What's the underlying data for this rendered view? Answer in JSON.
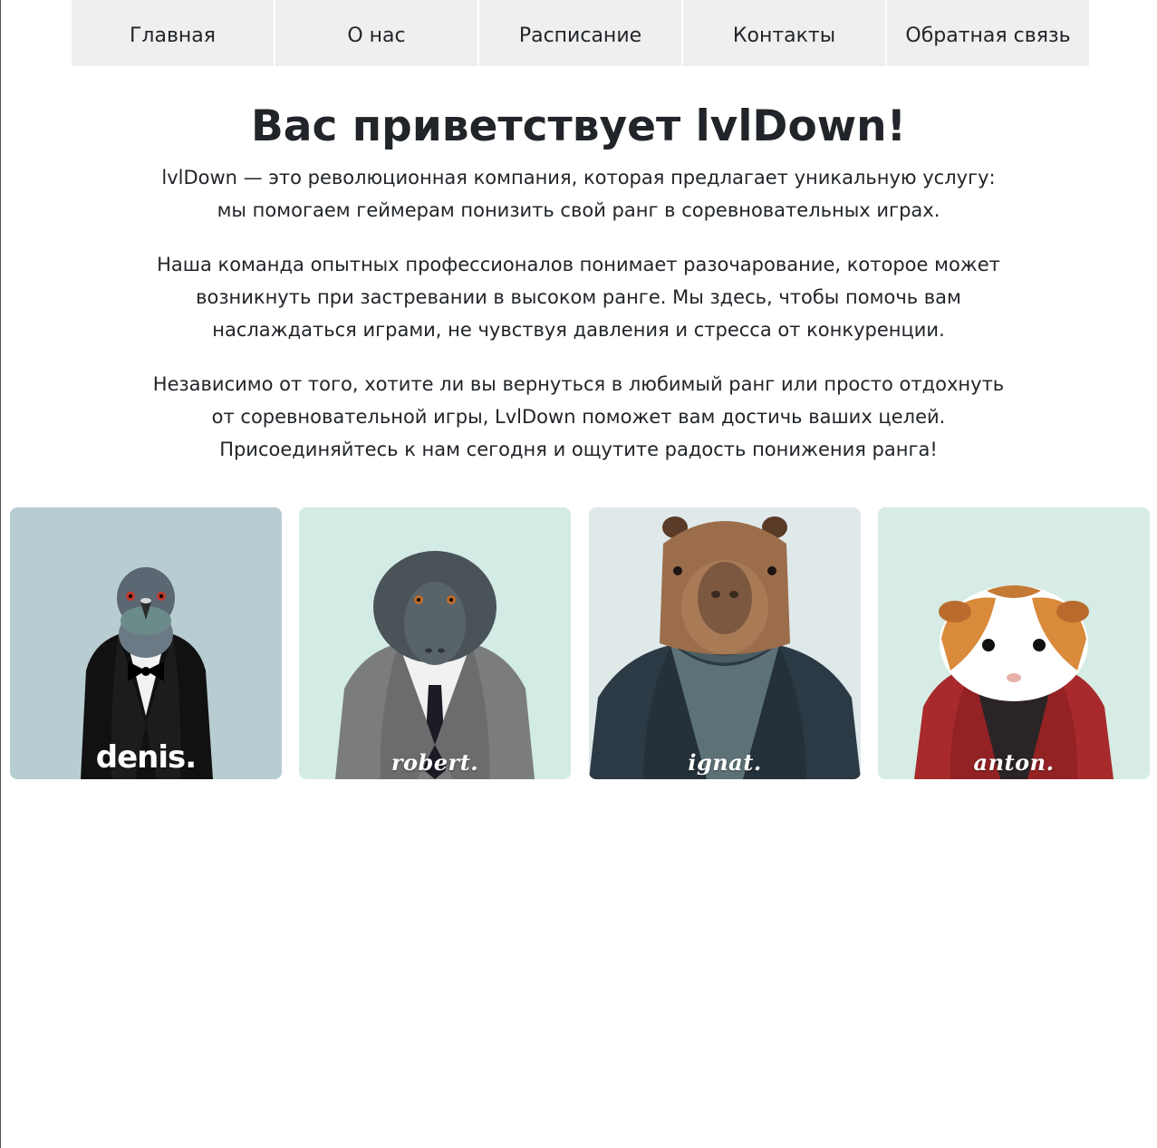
{
  "nav": {
    "items": [
      {
        "label": "Главная"
      },
      {
        "label": "О нас"
      },
      {
        "label": "Расписание"
      },
      {
        "label": "Контакты"
      },
      {
        "label": "Обратная связь"
      }
    ]
  },
  "main": {
    "title": "Вас приветствует lvlDown!",
    "paragraphs": [
      "lvlDown — это революционная компания, которая предлагает уникальную услугу: мы помогаем геймерам понизить свой ранг в соревновательных играх.",
      "Наша команда опытных профессионалов понимает разочарование, которое может возникнуть при застревании в высоком ранге. Мы здесь, чтобы помочь вам наслаждаться играми, не чувствуя давления и стресса от конкуренции.",
      "Независимо от того, хотите ли вы вернуться в любимый ранг или просто отдохнуть от соревновательной игры, LvlDown поможет вам достичь ваших целей. Присоединяйтесь к нам сегодня и ощутите радость понижения ранга!"
    ]
  },
  "team": {
    "members": [
      {
        "caption": "denis.",
        "animal_icon": "pigeon-in-tuxedo",
        "bg": "#b8cdd1"
      },
      {
        "caption": "robert.",
        "animal_icon": "macaque-in-suit",
        "bg": "#d3ebe5"
      },
      {
        "caption": "ignat.",
        "animal_icon": "capybara-in-jacket",
        "bg": "#dfe9ea"
      },
      {
        "caption": "anton.",
        "animal_icon": "guinea-pig-in-red-jacket",
        "bg": "#d6ece5"
      }
    ]
  }
}
